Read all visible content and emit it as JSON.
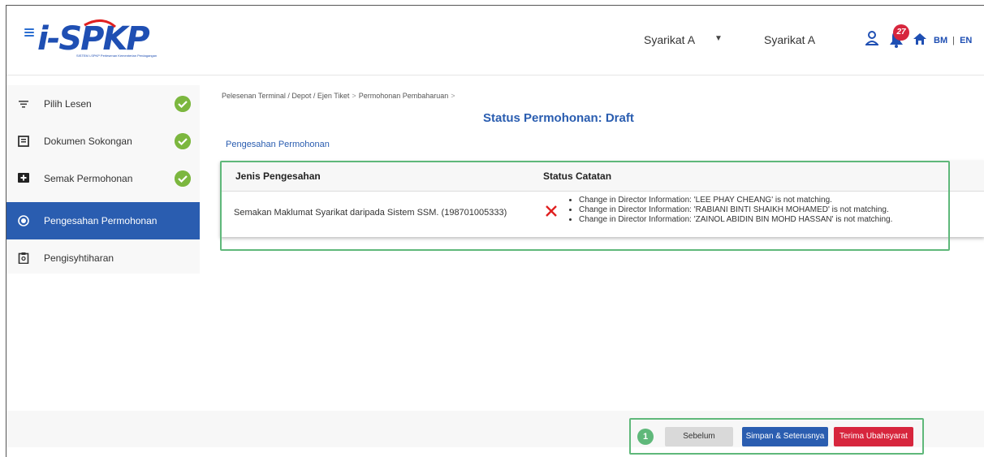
{
  "header": {
    "logo_text": "i-SPKP",
    "logo_subtitle": "SISTEM i-SPKP Perlesenan Kementerian Perdagangan",
    "company_select": "Syarikat A",
    "company_name": "Syarikat A",
    "notification_count": "27",
    "lang_bm": "BM",
    "lang_sep": "|",
    "lang_en": "EN"
  },
  "sidebar": {
    "items": [
      {
        "label": "Pilih Lesen",
        "icon": "filter-icon",
        "completed": true
      },
      {
        "label": "Dokumen Sokongan",
        "icon": "document-list-icon",
        "completed": true
      },
      {
        "label": "Semak Permohonan",
        "icon": "add-box-icon",
        "completed": true
      },
      {
        "label": "Pengesahan Permohonan",
        "icon": "verify-icon",
        "completed": false,
        "active": true
      },
      {
        "label": "Pengisyhtiharan",
        "icon": "clipboard-icon",
        "completed": false
      }
    ]
  },
  "breadcrumb": [
    "Pelesenan Terminal / Depot / Ejen Tiket",
    "Permohonan Pembaharuan"
  ],
  "page_title": "Status Permohonan: Draft",
  "section_title": "Pengesahan Permohonan",
  "table": {
    "headers": [
      "Jenis Pengesahan",
      "Status Catatan"
    ],
    "rows": [
      {
        "type": "Semakan Maklumat Syarikat daripada Sistem SSM. (198701005333)",
        "status_icon": "cross-icon",
        "notes": [
          "Change in Director Information: 'LEE PHAY CHEANG' is not matching.",
          "Change in Director Information: 'RABIANI BINTI SHAIKH MOHAMED' is not matching.",
          "Change in Director Information: 'ZAINOL ABIDIN BIN MOHD HASSAN' is not matching."
        ]
      }
    ]
  },
  "footer": {
    "step_marker": "1",
    "prev_label": "Sebelum",
    "next_label": "Simpan & Seterusnya",
    "accept_label": "Terima Ubahsyarat"
  },
  "colors": {
    "primary": "#2a5db0",
    "danger": "#d7263d",
    "success": "#7cb73f",
    "highlight": "#5fb87a"
  }
}
